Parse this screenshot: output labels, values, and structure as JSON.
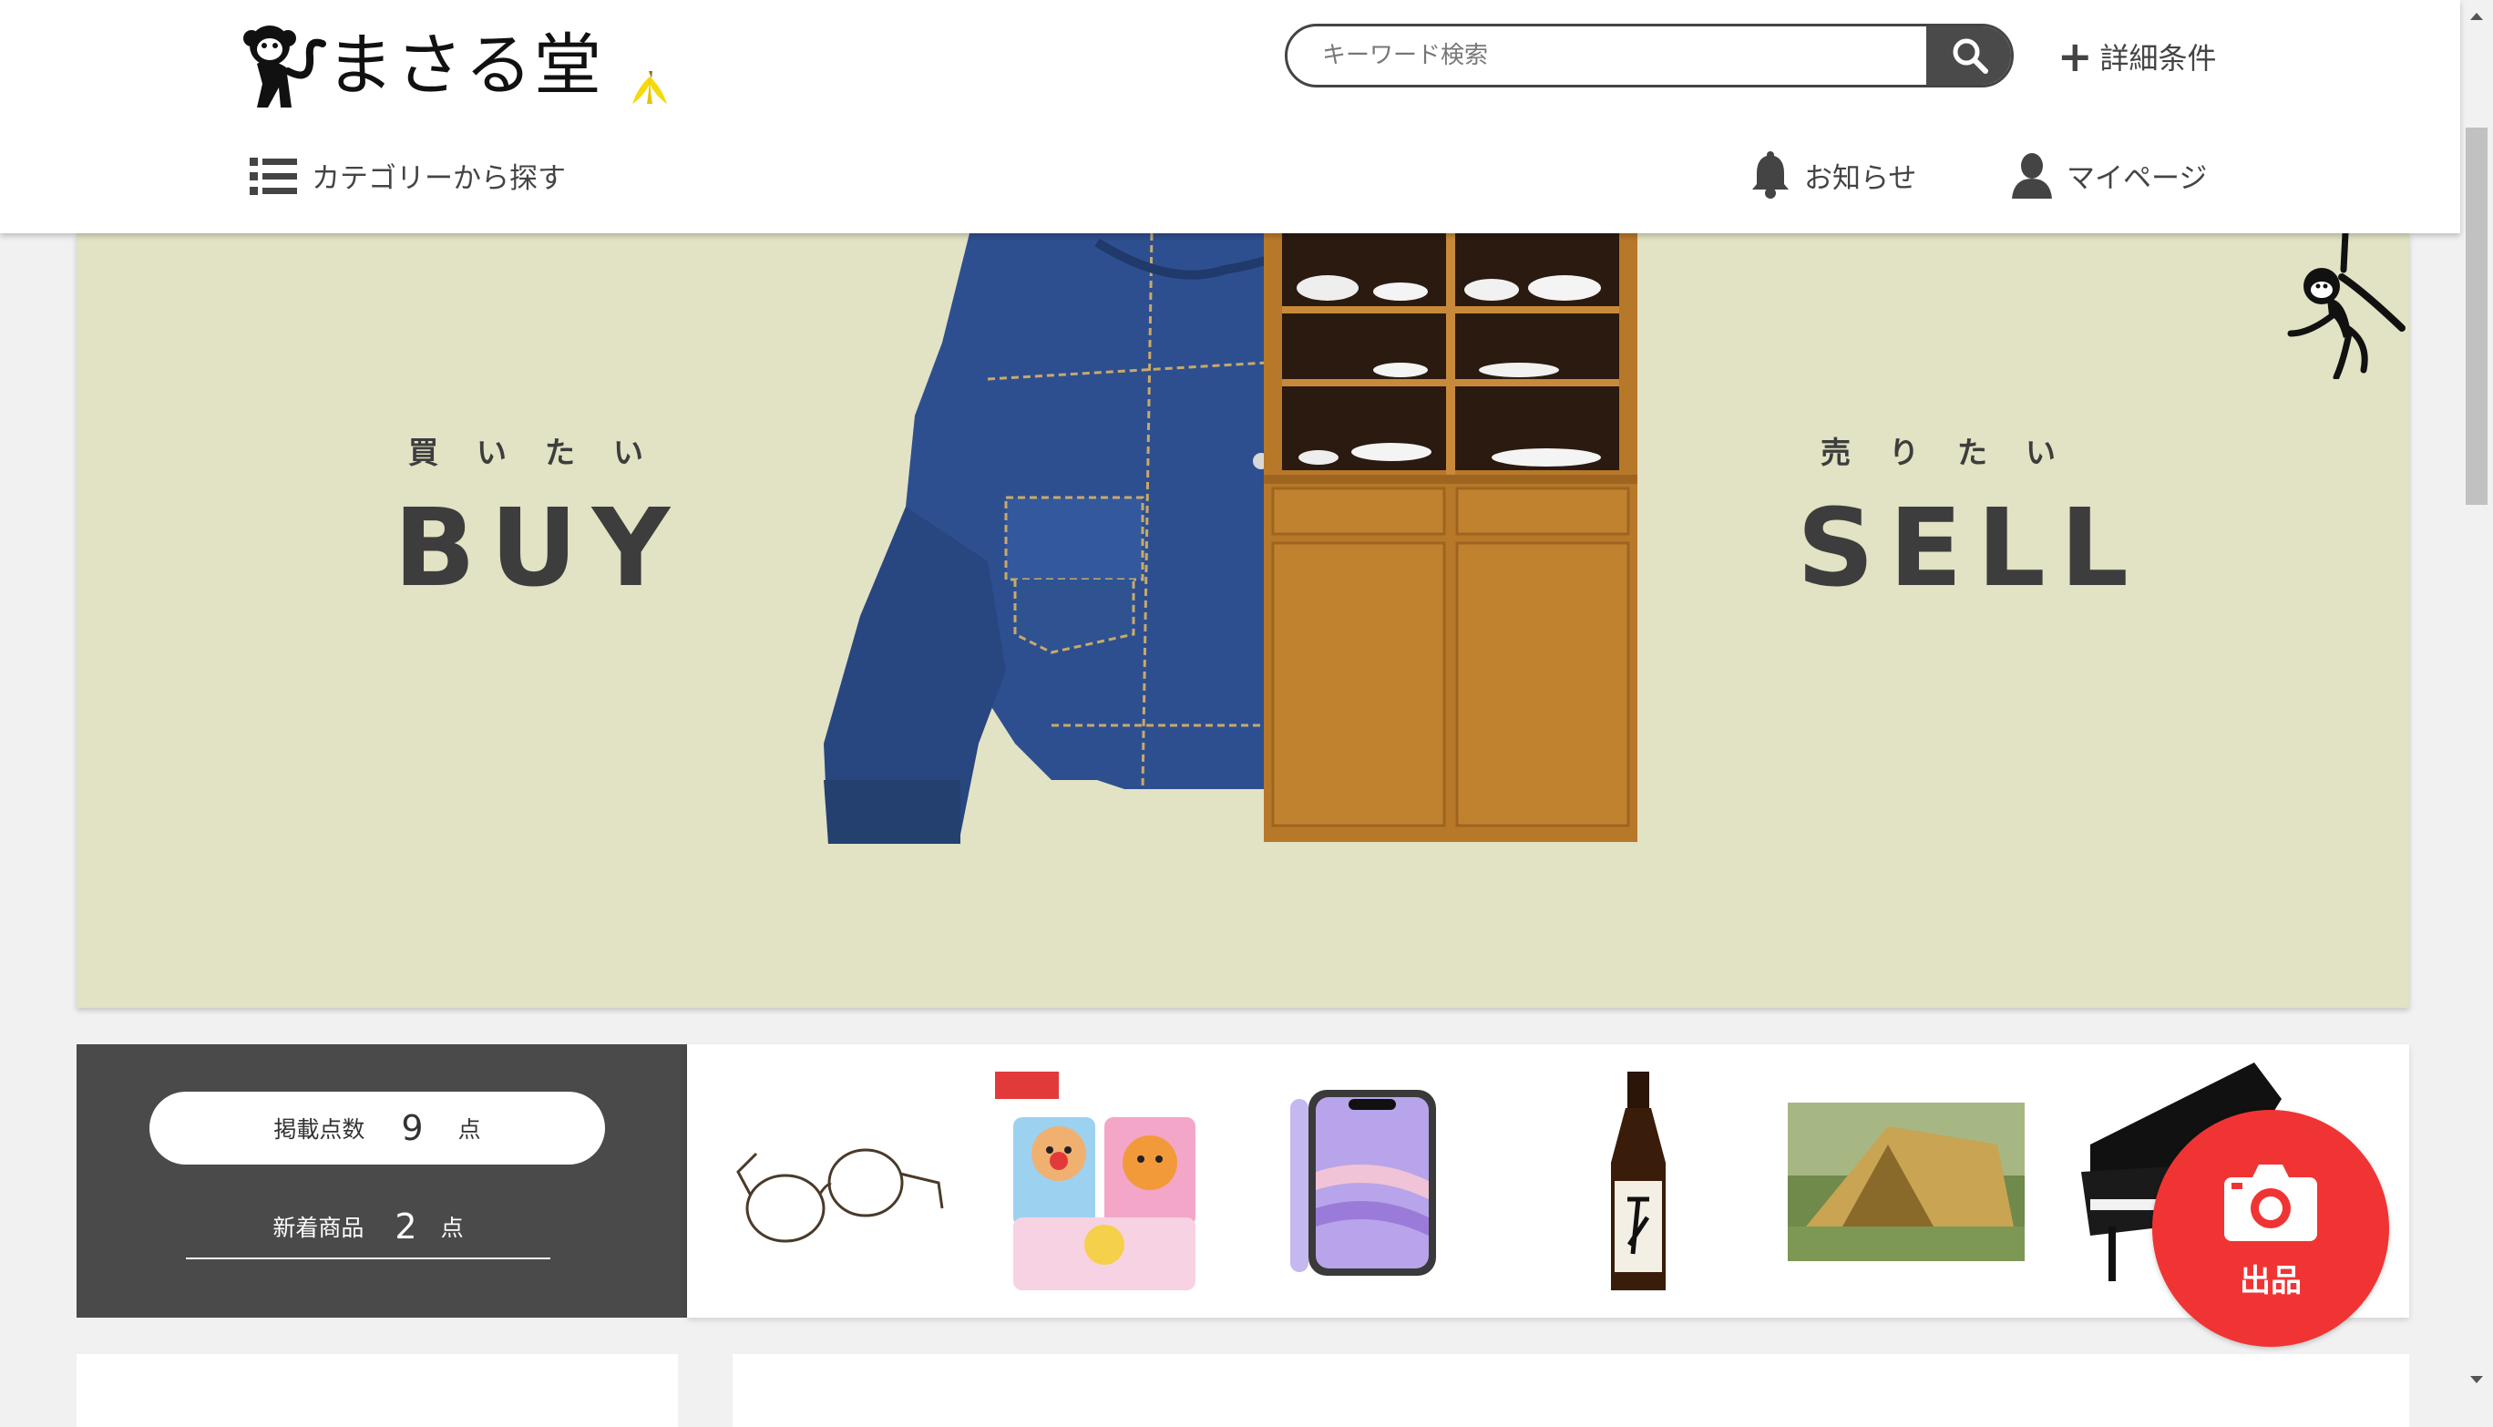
{
  "header": {
    "logo_text": "まさる堂",
    "search": {
      "placeholder": "キーワード検索"
    },
    "detail_label": "詳細条件",
    "nav": {
      "category_label": "カテゴリーから探す",
      "notice_label": "お知らせ",
      "mypage_label": "マイページ"
    }
  },
  "hero": {
    "buy_sub": "買いたい",
    "buy_main": "BUY",
    "sell_sub": "売りたい",
    "sell_main": "SELL",
    "background_color": "#e2e2c4"
  },
  "stats": {
    "listed": {
      "label": "掲載点数",
      "count": "9",
      "unit": "点"
    },
    "new_items": {
      "label": "新着商品",
      "count": "2",
      "unit": "点"
    }
  },
  "products": [
    {
      "icon": "glasses-icon"
    },
    {
      "icon": "anpanman-toys-icon"
    },
    {
      "icon": "smartphone-icon"
    },
    {
      "icon": "sake-bottle-icon"
    },
    {
      "icon": "tent-icon"
    },
    {
      "icon": "grand-piano-icon"
    }
  ],
  "fab": {
    "label": "出品",
    "color": "#f03434"
  },
  "colors": {
    "dark": "#4a4a4a",
    "accent": "#f03434",
    "banana": "#f5d90a"
  }
}
